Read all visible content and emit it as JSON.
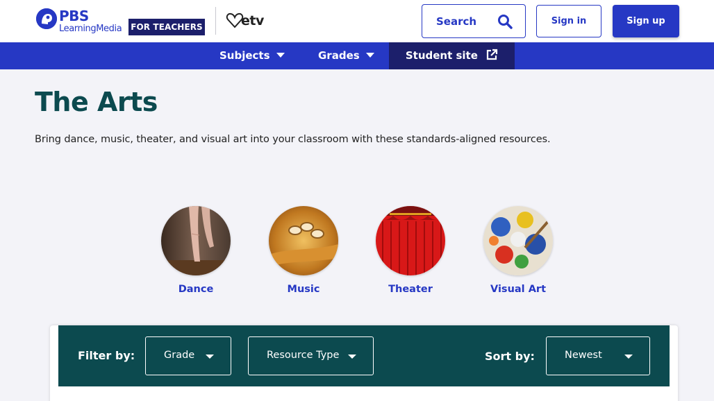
{
  "header": {
    "logo_brand": "PBS",
    "logo_sub": "LearningMedia",
    "audience_badge": "FOR TEACHERS",
    "partner_logo": "etv",
    "search_label": "Search",
    "signin_label": "Sign in",
    "signup_label": "Sign up"
  },
  "nav": {
    "items": [
      {
        "label": "Subjects",
        "icon": "chevron-down-icon"
      },
      {
        "label": "Grades",
        "icon": "chevron-down-icon"
      },
      {
        "label": "Student site",
        "icon": "external-link-icon"
      }
    ]
  },
  "main": {
    "title": "The Arts",
    "description": "Bring dance, music, theater, and visual art into your classroom with these standards-aligned resources.",
    "categories": [
      {
        "label": "Dance"
      },
      {
        "label": "Music"
      },
      {
        "label": "Theater"
      },
      {
        "label": "Visual Art"
      }
    ]
  },
  "filters": {
    "filter_label": "Filter by:",
    "grade": "Grade",
    "resource_type": "Resource Type",
    "sort_label": "Sort by:",
    "sort_value": "Newest"
  },
  "colors": {
    "brand_blue": "#2638c4",
    "dark_navy": "#1c1f6b",
    "teal": "#0c4a4f",
    "background": "#f3f3f8"
  }
}
